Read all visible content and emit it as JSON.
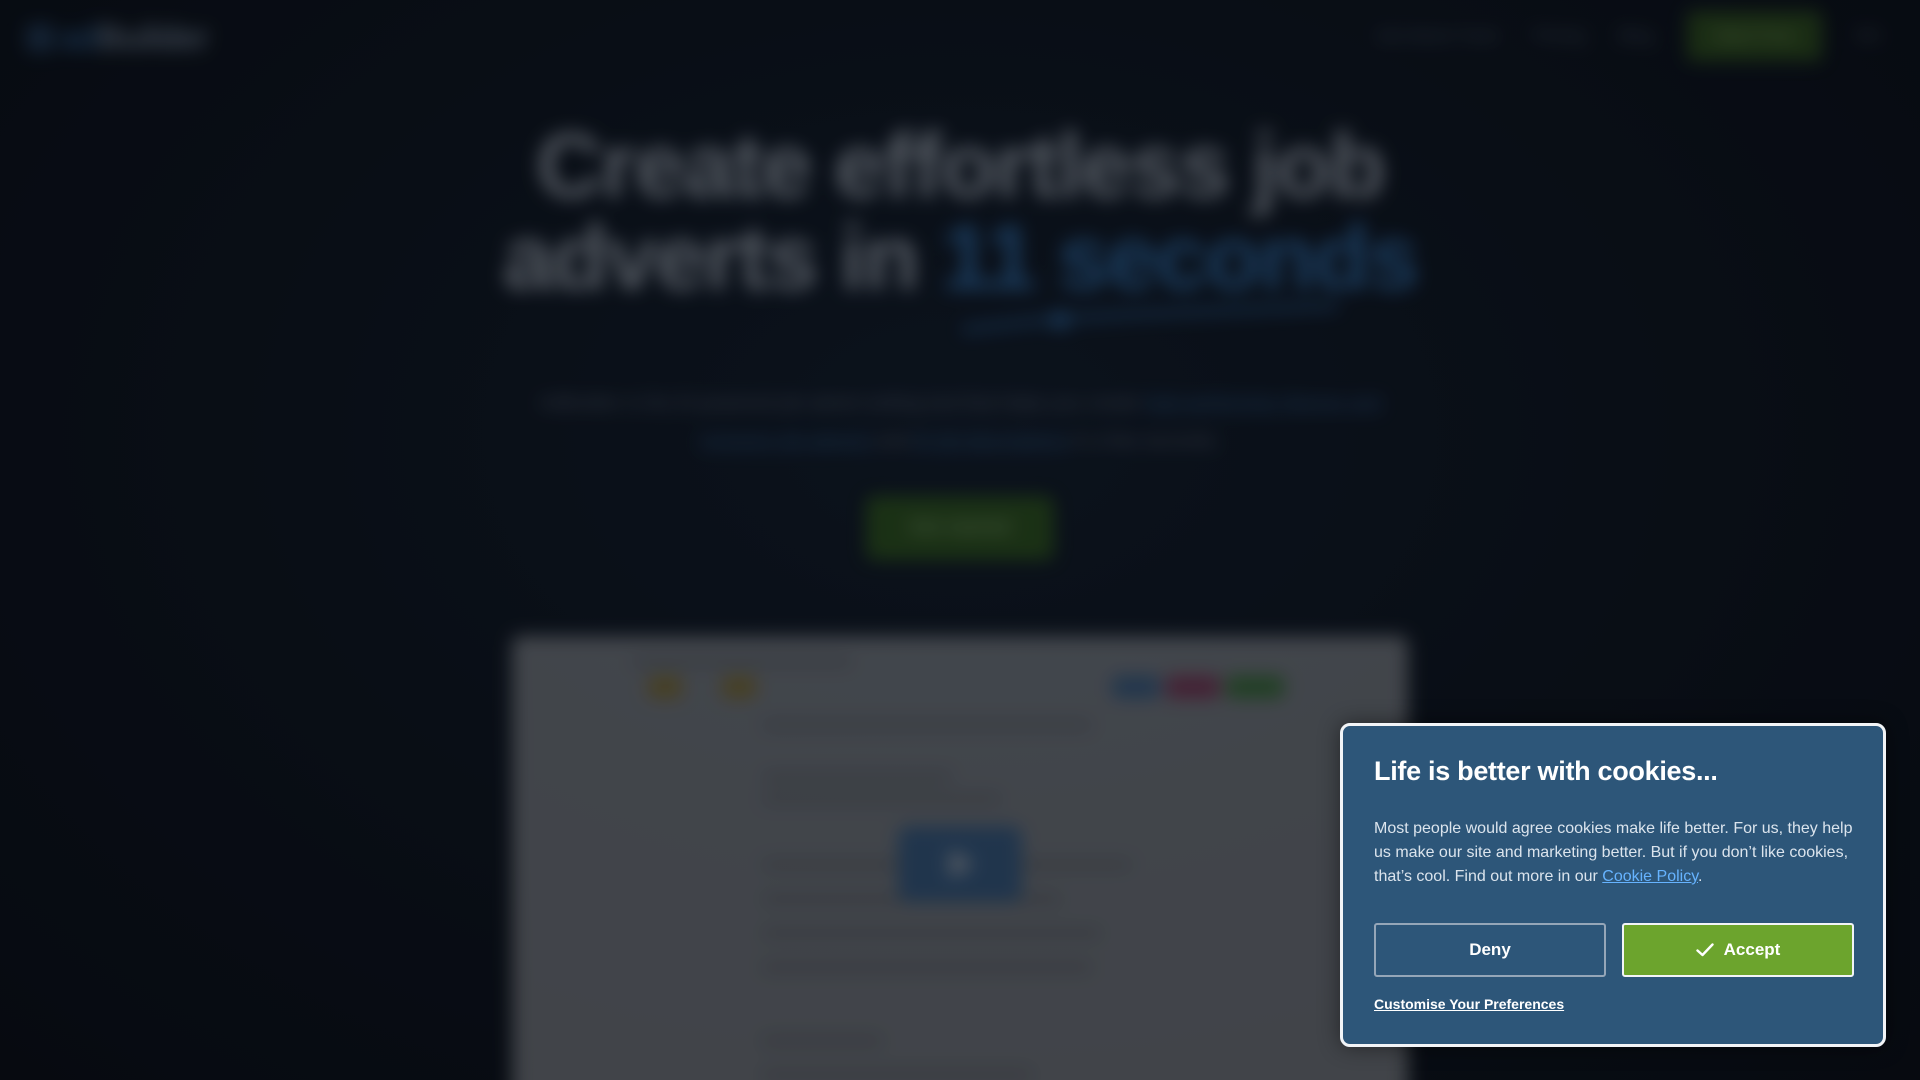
{
  "header": {
    "logo_prefix": "ad",
    "logo_suffix": "Builder",
    "nav_items": [
      "Job Advert Tools",
      "Pricing",
      "Blog"
    ],
    "cta_label": "Start Free",
    "language": "EN"
  },
  "hero": {
    "title_line1": "Create effortless job",
    "title_line2_plain": "adverts in ",
    "title_line2_highlight": "11 seconds",
    "subtitle_parts": {
      "text_a": "AdBuilder is the AI-powered job advert writing tool that helps you create",
      "link_a": "high-performing",
      "link_b": "diverse and inclusive job adverts",
      "text_b": " and ",
      "link_c": "AI job descriptions",
      "text_c": " in a few seconds."
    },
    "cta_label": "Get started"
  },
  "cookie_dialog": {
    "title": "Life is better with cookies...",
    "body_text": "Most people would agree cookies make life better. For us, they help us make our site and marketing better. But if you don’t like cookies, that’s cool. Find out more in our ",
    "policy_link": "Cookie Policy",
    "body_end": ".",
    "deny_label": "Deny",
    "accept_label": "Accept",
    "customise_label": "Customise Your Preferences",
    "colors": {
      "panel": "#2d5679",
      "accept": "#6ca42d",
      "link": "#66b3ff"
    }
  }
}
